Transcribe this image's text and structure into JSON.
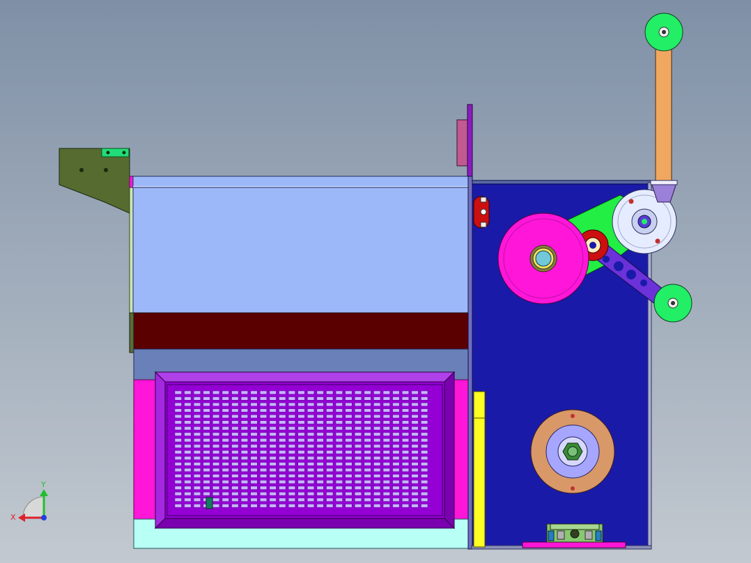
{
  "viewport": {
    "background_top": "#7f90a6",
    "background_bottom": "#c2c9d0"
  },
  "triad": {
    "x_label": "X",
    "y_label": "Y",
    "x_color": "#e0202a",
    "y_color": "#1fc02f",
    "z_color": "#2040e0"
  },
  "colors": {
    "left_bracket": "#556b2f",
    "bin_upper": "#9db8f8",
    "bin_band": "#5a0000",
    "grille_frame": "#9400d3",
    "grille_slots": "#c8b6ff",
    "magenta_panel": "#ff16d8",
    "cyan_panel": "#b8fff6",
    "right_panel": "#1a1aa8",
    "pink_reel": "#ff16d8",
    "white_pulley": "#e6ecff",
    "green_roller": "#22ee66",
    "orange_post": "#f0a860",
    "tan_disc": "#d99868",
    "lavender_disc": "#a6a6ff",
    "yellow_strip": "#ffff22",
    "green_plate": "#22dd44",
    "purple_arm": "#6a32d8"
  },
  "icons": [
    "coordinate-triad-icon"
  ]
}
